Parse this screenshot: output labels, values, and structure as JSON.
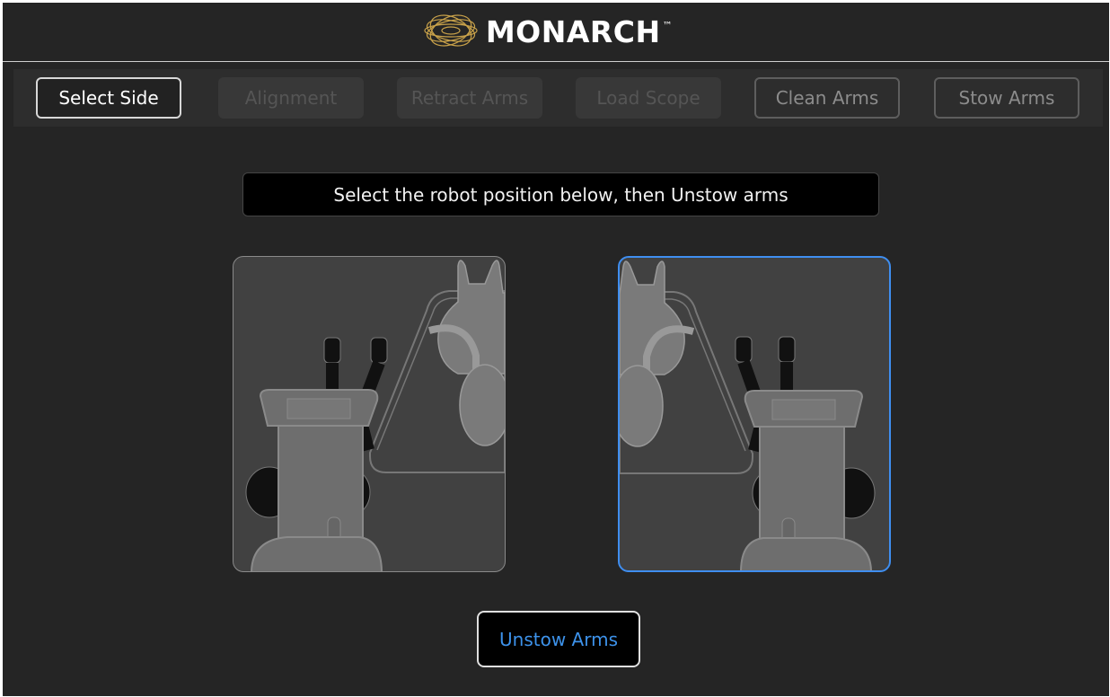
{
  "header": {
    "brand": "MONARCH",
    "trademark": "™",
    "logo_icon": "monarch-butterfly-logo",
    "logo_color": "#c9a24a"
  },
  "steps": [
    {
      "label": "Select Side",
      "state": "active"
    },
    {
      "label": "Alignment",
      "state": "disabled"
    },
    {
      "label": "Retract Arms",
      "state": "disabled"
    },
    {
      "label": "Load Scope",
      "state": "disabled"
    },
    {
      "label": "Clean Arms",
      "state": "enabled"
    },
    {
      "label": "Stow Arms",
      "state": "enabled"
    }
  ],
  "instruction": "Select the robot position below, then Unstow arms",
  "positions": [
    {
      "id": "left",
      "icon": "robot-cart-left-of-table",
      "selected": false
    },
    {
      "id": "right",
      "icon": "robot-cart-right-of-table",
      "selected": true
    }
  ],
  "unstow_button": "Unstow Arms",
  "colors": {
    "background": "#252525",
    "selected_border": "#3f8ef0",
    "accent_text": "#3d92ea"
  }
}
